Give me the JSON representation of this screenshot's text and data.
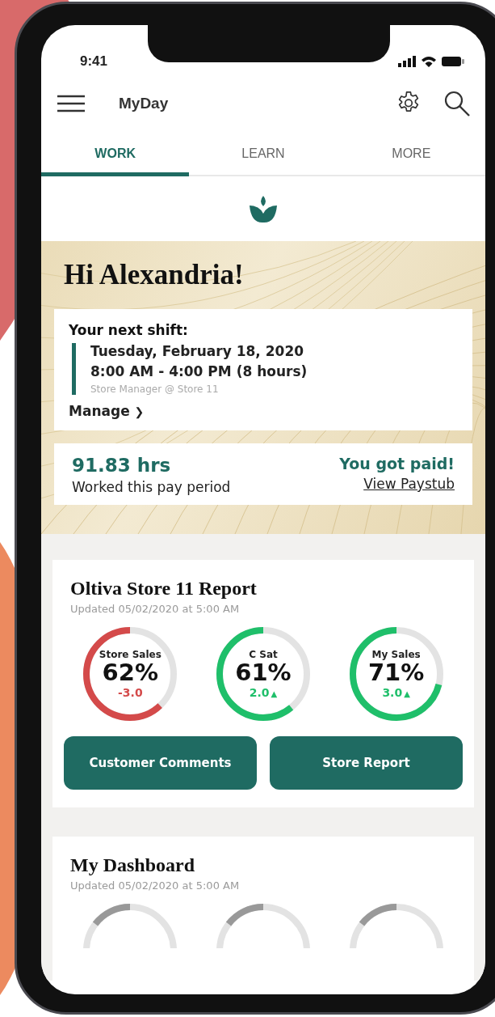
{
  "status_bar": {
    "time": "9:41"
  },
  "app_bar": {
    "title": "MyDay"
  },
  "tabs": [
    {
      "label": "WORK",
      "selected": true
    },
    {
      "label": "LEARN",
      "selected": false
    },
    {
      "label": "MORE",
      "selected": false
    }
  ],
  "greeting": "Hi Alexandria!",
  "next_shift": {
    "heading": "Your next shift:",
    "date": "Tuesday, February 18, 2020",
    "time": "8:00 AM - 4:00 PM (8 hours)",
    "role": "Store Manager @ Store 11",
    "link": "Manage",
    "link_icon": "❯"
  },
  "pay": {
    "hours": "91.83 hrs",
    "hours_label": "Worked this pay period",
    "message": "You got paid!",
    "link": "View Paystub"
  },
  "report": {
    "title": "Oltiva Store 11 Report",
    "updated": "Updated 05/02/2020 at 5:00 AM",
    "gauges": [
      {
        "label": "Store Sales",
        "value": "62%",
        "delta": "-3.0",
        "color": "#d44a4a",
        "level": 0.62
      },
      {
        "label": "C Sat",
        "value": "61%",
        "delta": "2.0",
        "arrow": "▲",
        "color": "#1fbf6a",
        "level": 0.61
      },
      {
        "label": "My Sales",
        "value": "71%",
        "delta": "3.0",
        "arrow": "▲",
        "color": "#1fbf6a",
        "level": 0.71
      }
    ],
    "buttons": [
      "Customer Comments",
      "Store Report"
    ]
  },
  "dashboard": {
    "title": "My Dashboard",
    "updated": "Updated 05/02/2020 at 5:00 AM"
  }
}
